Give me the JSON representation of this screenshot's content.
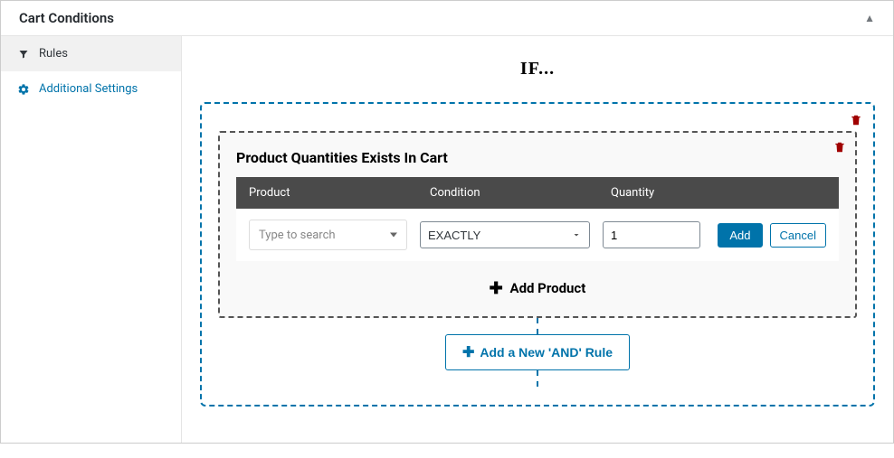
{
  "panel": {
    "title": "Cart Conditions"
  },
  "sidebar": {
    "items": [
      {
        "label": "Rules"
      },
      {
        "label": "Additional Settings"
      }
    ]
  },
  "main": {
    "if_heading": "IF...",
    "rule": {
      "title": "Product Quantities Exists In Cart",
      "columns": {
        "product": "Product",
        "condition": "Condition",
        "quantity": "Quantity"
      },
      "row": {
        "product_placeholder": "Type to search",
        "condition_value": "EXACTLY",
        "quantity_value": "1",
        "add_label": "Add",
        "cancel_label": "Cancel"
      },
      "add_product_label": "Add Product"
    },
    "add_and_rule_label": "Add a New 'AND' Rule"
  }
}
